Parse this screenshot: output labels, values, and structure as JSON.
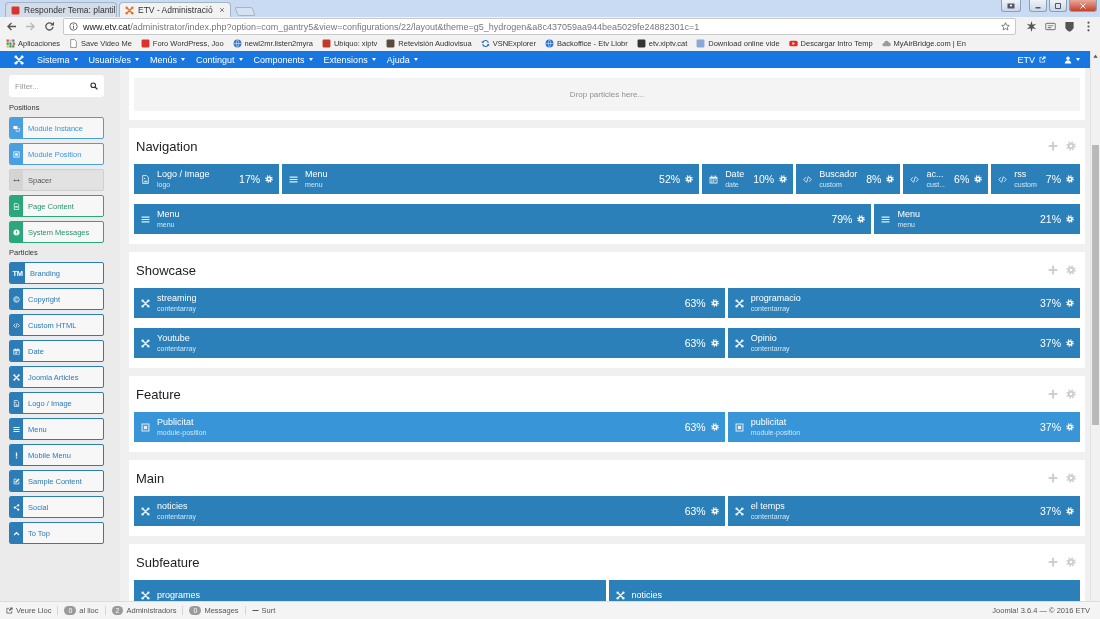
{
  "browser": {
    "tabs": [
      {
        "title": "Responder Tema: plantil",
        "selected": false
      },
      {
        "title": "ETV - Administració",
        "selected": true
      }
    ],
    "address": {
      "host": "www.etv.cat",
      "path": "/administrator/index.php?option=com_gantry5&view=configurations/22/layout&theme=g5_hydrogen&a8c437059aa944bea5029fe24882301c=1"
    },
    "bookmarks": [
      "Aplicaciones",
      "Save Video Me",
      "Foro WordPress, Joo",
      "newl2mr.listen2myra",
      "Ubiquo: xiptv",
      "Retevisión Audiovisua",
      "VSNExplorer",
      "Backoffice - Etv Llobr",
      "etv.xiptv.cat",
      "Download online vide",
      "Descargar Intro Temp",
      "MyAirBridge.com | En"
    ]
  },
  "menu_bar": {
    "items": [
      "Sistema",
      "Usuaris/es",
      "Menús",
      "Contingut",
      "Components",
      "Extensions",
      "Ajuda"
    ],
    "site_link": "ETV"
  },
  "sidebar": {
    "filter": {
      "placeholder": "Filter..."
    },
    "positions": {
      "heading": "Positions",
      "items": [
        {
          "label": "Module Instance",
          "kind": "module"
        },
        {
          "label": "Module Position",
          "kind": "module"
        },
        {
          "label": "Spacer",
          "kind": "spacer"
        },
        {
          "label": "Page Content",
          "kind": "content"
        },
        {
          "label": "System Messages",
          "kind": "content"
        }
      ]
    },
    "particles": {
      "heading": "Particles",
      "items": [
        {
          "label": "Branding",
          "glyph": "TM"
        },
        {
          "label": "Copyright"
        },
        {
          "label": "Custom HTML"
        },
        {
          "label": "Date"
        },
        {
          "label": "Joomla Articles"
        },
        {
          "label": "Logo / Image"
        },
        {
          "label": "Menu"
        },
        {
          "label": "Mobile Menu"
        },
        {
          "label": "Sample Content"
        },
        {
          "label": "Social"
        },
        {
          "label": "To Top"
        }
      ]
    }
  },
  "drop_zone": "Drop particles here...",
  "sections": [
    {
      "title": "Navigation",
      "rows": [
        {
          "particles": [
            {
              "title": "Logo / Image",
              "subtitle": "logo",
              "kind": "logo",
              "percent": "17%"
            },
            {
              "title": "Menu",
              "subtitle": "menu",
              "kind": "menu",
              "percent": "52%"
            },
            {
              "title": "Date",
              "subtitle": "date",
              "kind": "date",
              "percent": "10%"
            },
            {
              "title": "Buscador",
              "subtitle": "custom",
              "kind": "custom",
              "percent": "8%"
            },
            {
              "title": "ac...",
              "subtitle": "cust...",
              "kind": "custom",
              "percent": "6%"
            },
            {
              "title": "rss",
              "subtitle": "custom",
              "kind": "custom",
              "percent": "7%"
            }
          ]
        },
        {
          "particles": [
            {
              "title": "Menu",
              "subtitle": "menu",
              "kind": "menu",
              "percent": "79%"
            },
            {
              "title": "Menu",
              "subtitle": "menu",
              "kind": "menu",
              "percent": "21%"
            }
          ]
        }
      ]
    },
    {
      "title": "Showcase",
      "rows": [
        {
          "particles": [
            {
              "title": "streaming",
              "subtitle": "contentarray",
              "kind": "contentarray",
              "percent": "63%"
            },
            {
              "title": "programacio",
              "subtitle": "contentarray",
              "kind": "contentarray",
              "percent": "37%"
            }
          ]
        },
        {
          "particles": [
            {
              "title": "Youtube",
              "subtitle": "contentarray",
              "kind": "contentarray",
              "percent": "63%"
            },
            {
              "title": "Opinio",
              "subtitle": "contentarray",
              "kind": "contentarray",
              "percent": "37%"
            }
          ]
        }
      ]
    },
    {
      "title": "Feature",
      "rows": [
        {
          "particles": [
            {
              "title": "Publicitat",
              "subtitle": "module-position",
              "kind": "position",
              "percent": "63%"
            },
            {
              "title": "publicitat",
              "subtitle": "module-position",
              "kind": "position",
              "percent": "37%"
            }
          ]
        }
      ]
    },
    {
      "title": "Main",
      "rows": [
        {
          "particles": [
            {
              "title": "noticies",
              "subtitle": "contentarray",
              "kind": "contentarray",
              "percent": "63%"
            },
            {
              "title": "el temps",
              "subtitle": "contentarray",
              "kind": "contentarray",
              "percent": "37%"
            }
          ]
        }
      ]
    },
    {
      "title": "Subfeature",
      "rows": [
        {
          "particles": [
            {
              "title": "programes",
              "kind": "contentarray"
            },
            {
              "title": "noticies",
              "kind": "contentarray"
            }
          ]
        }
      ]
    }
  ],
  "status_bar": {
    "items": [
      {
        "kind": "link",
        "label": "Veure Lloc"
      },
      {
        "kind": "count",
        "count": "0",
        "label": "al lloc"
      },
      {
        "kind": "count",
        "count": "2",
        "label": "Administradors"
      },
      {
        "kind": "count",
        "count": "0",
        "label": "Messages"
      },
      {
        "kind": "logout",
        "label": "Surt"
      }
    ],
    "version": "Joomla! 3.6.4 — © 2016 ETV"
  }
}
